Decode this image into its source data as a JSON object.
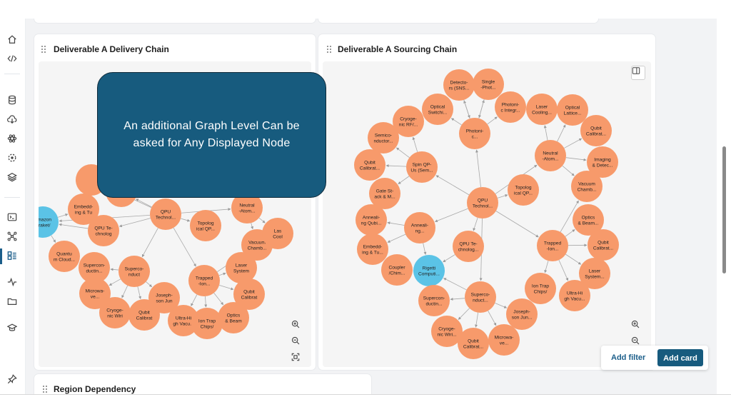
{
  "cards": {
    "delivery": {
      "title": "Deliverable A Delivery Chain"
    },
    "sourcing": {
      "title": "Deliverable A Sourcing Chain"
    },
    "region": {
      "title": "Region Dependency"
    }
  },
  "callout": {
    "text": "An additional Graph Level Can be asked for Any Displayed Node"
  },
  "actions": {
    "add_filter": "Add filter",
    "add_card": "Add card"
  },
  "colors": {
    "node": "#f79a6b",
    "node_highlight": "#5bc3e6",
    "callout_bg": "#175b7e",
    "accent": "#1b5e8a"
  },
  "sidebar_icons": [
    "home-icon",
    "code-icon",
    "database-icon",
    "cloud-download-icon",
    "atom-icon",
    "dashed-circle-icon",
    "layers-icon",
    "terminal-icon",
    "network-icon",
    "dashboard-icon",
    "activity-icon",
    "folder-icon",
    "graduation-icon",
    "pin-icon"
  ],
  "delivery_graph": {
    "nodes": [
      {
        "id": "d_embedd",
        "label": [
          "Embedd-",
          "ing & Tu"
        ]
      },
      {
        "id": "d_amazon",
        "label": [
          "Amazon",
          "Braket/"
        ],
        "highlight": true
      },
      {
        "id": "d_qpute",
        "label": [
          "QPU Te-",
          "chnolog"
        ]
      },
      {
        "id": "d_qputech",
        "label": [
          "QPU",
          "Technol..."
        ]
      },
      {
        "id": "d_topo",
        "label": [
          "Topolog",
          "ical QP..."
        ]
      },
      {
        "id": "d_neutral",
        "label": [
          "Neutral",
          "-Atom..."
        ]
      },
      {
        "id": "d_quantum",
        "label": [
          "Quantu",
          "m Cloud..."
        ]
      },
      {
        "id": "d_super1",
        "label": [
          "Supercon-",
          "ductin..."
        ]
      },
      {
        "id": "d_super2",
        "label": [
          "Superco-",
          "nduct"
        ]
      },
      {
        "id": "d_vacuum",
        "label": [
          "Vacuum",
          "Chamb..."
        ]
      },
      {
        "id": "d_laser",
        "label": [
          "Laser",
          "System"
        ]
      },
      {
        "id": "d_trapped",
        "label": [
          "Trapped",
          "-Ion..."
        ]
      },
      {
        "id": "d_micro",
        "label": [
          "Microwa-",
          "ve..."
        ]
      },
      {
        "id": "d_joseph",
        "label": [
          "Joseph-",
          "son Jun"
        ]
      },
      {
        "id": "d_qubit1",
        "label": [
          "Qubit",
          "Calibrat"
        ]
      },
      {
        "id": "d_qubit2",
        "label": [
          "Qubit",
          "Calibrat"
        ]
      },
      {
        "id": "d_cryo",
        "label": [
          "Cryoge-",
          "nic Wiri"
        ]
      },
      {
        "id": "d_ultra",
        "label": [
          "Ultra-Hi",
          "gh Vacu..."
        ]
      },
      {
        "id": "d_iontrap",
        "label": [
          "Ion Trap",
          "Chips/"
        ]
      },
      {
        "id": "d_optics",
        "label": [
          "Optics",
          "& Beam"
        ]
      },
      {
        "id": "d_lasc",
        "label": [
          "Las",
          "Cool"
        ]
      },
      {
        "id": "d_top1",
        "label": [
          ""
        ]
      },
      {
        "id": "d_top2",
        "label": [
          ""
        ]
      }
    ]
  },
  "sourcing_graph": {
    "nodes": [
      {
        "id": "s_detect",
        "label": [
          "Detecto-",
          "rs (SNS..."
        ]
      },
      {
        "id": "s_single",
        "label": [
          "Single",
          "-Phot..."
        ]
      },
      {
        "id": "s_optsw",
        "label": [
          "Optical",
          "Switchi..."
        ]
      },
      {
        "id": "s_photint",
        "label": [
          "Photoni-",
          "c Integr..."
        ]
      },
      {
        "id": "s_lascool",
        "label": [
          "Laser",
          "Cooling..."
        ]
      },
      {
        "id": "s_optlat",
        "label": [
          "Optical",
          "Lattice..."
        ]
      },
      {
        "id": "s_cryorf",
        "label": [
          "Cryoge-",
          "nic RF/..."
        ]
      },
      {
        "id": "s_photonic",
        "label": [
          "Photoni-",
          "c..."
        ]
      },
      {
        "id": "s_qubcal1",
        "label": [
          "Qubit",
          "Calibrat..."
        ]
      },
      {
        "id": "s_semi",
        "label": [
          "Semico-",
          "nductor..."
        ]
      },
      {
        "id": "s_neutral",
        "label": [
          "Neutral",
          "-Atom..."
        ]
      },
      {
        "id": "s_imaging",
        "label": [
          "Imaging",
          "& Detec..."
        ]
      },
      {
        "id": "s_qubcal2",
        "label": [
          "Qubit",
          "Calibrat..."
        ]
      },
      {
        "id": "s_spin",
        "label": [
          "Spin QP-",
          "Us (Sem..."
        ]
      },
      {
        "id": "s_topo",
        "label": [
          "Topolog",
          "ical QP..."
        ]
      },
      {
        "id": "s_vacuum",
        "label": [
          "Vacuum",
          "Chamb..."
        ]
      },
      {
        "id": "s_gate",
        "label": [
          "Gate St-",
          "ack & M..."
        ]
      },
      {
        "id": "s_qpu",
        "label": [
          "QPU",
          "Technol..."
        ]
      },
      {
        "id": "s_anneal1",
        "label": [
          "Anneali-",
          "ng Qubi..."
        ]
      },
      {
        "id": "s_anneal2",
        "label": [
          "Anneali-",
          "ng..."
        ]
      },
      {
        "id": "s_optics",
        "label": [
          "Optics",
          "& Beam..."
        ]
      },
      {
        "id": "s_qpute",
        "label": [
          "QPU Te-",
          "chnolog..."
        ]
      },
      {
        "id": "s_embedd",
        "label": [
          "Embedd-",
          "ing & Tu..."
        ]
      },
      {
        "id": "s_trapped",
        "label": [
          "Trapped",
          "-Ion..."
        ]
      },
      {
        "id": "s_qubcal3",
        "label": [
          "Qubit",
          "Calibrat..."
        ]
      },
      {
        "id": "s_coupler",
        "label": [
          "Coupler",
          "/Chim..."
        ]
      },
      {
        "id": "s_rigetti",
        "label": [
          "Rigetti",
          "Computi..."
        ],
        "highlight": true
      },
      {
        "id": "s_lasersys",
        "label": [
          "Laser",
          "System..."
        ]
      },
      {
        "id": "s_super1",
        "label": [
          "Superco-",
          "nduct..."
        ]
      },
      {
        "id": "s_iontrap",
        "label": [
          "Ion Trap",
          "Chips/"
        ]
      },
      {
        "id": "s_ultra",
        "label": [
          "Ultra-Hi",
          "gh Vacu..."
        ]
      },
      {
        "id": "s_super2",
        "label": [
          "Supercon-",
          "ductin..."
        ]
      },
      {
        "id": "s_joseph",
        "label": [
          "Joseph-",
          "son Jun..."
        ]
      },
      {
        "id": "s_cryowir",
        "label": [
          "Cryoge-",
          "nic Wiri..."
        ]
      },
      {
        "id": "s_qubcal4",
        "label": [
          "Qubit",
          "Calibrat..."
        ]
      },
      {
        "id": "s_micro",
        "label": [
          "Microwa-",
          "ve..."
        ]
      }
    ]
  }
}
